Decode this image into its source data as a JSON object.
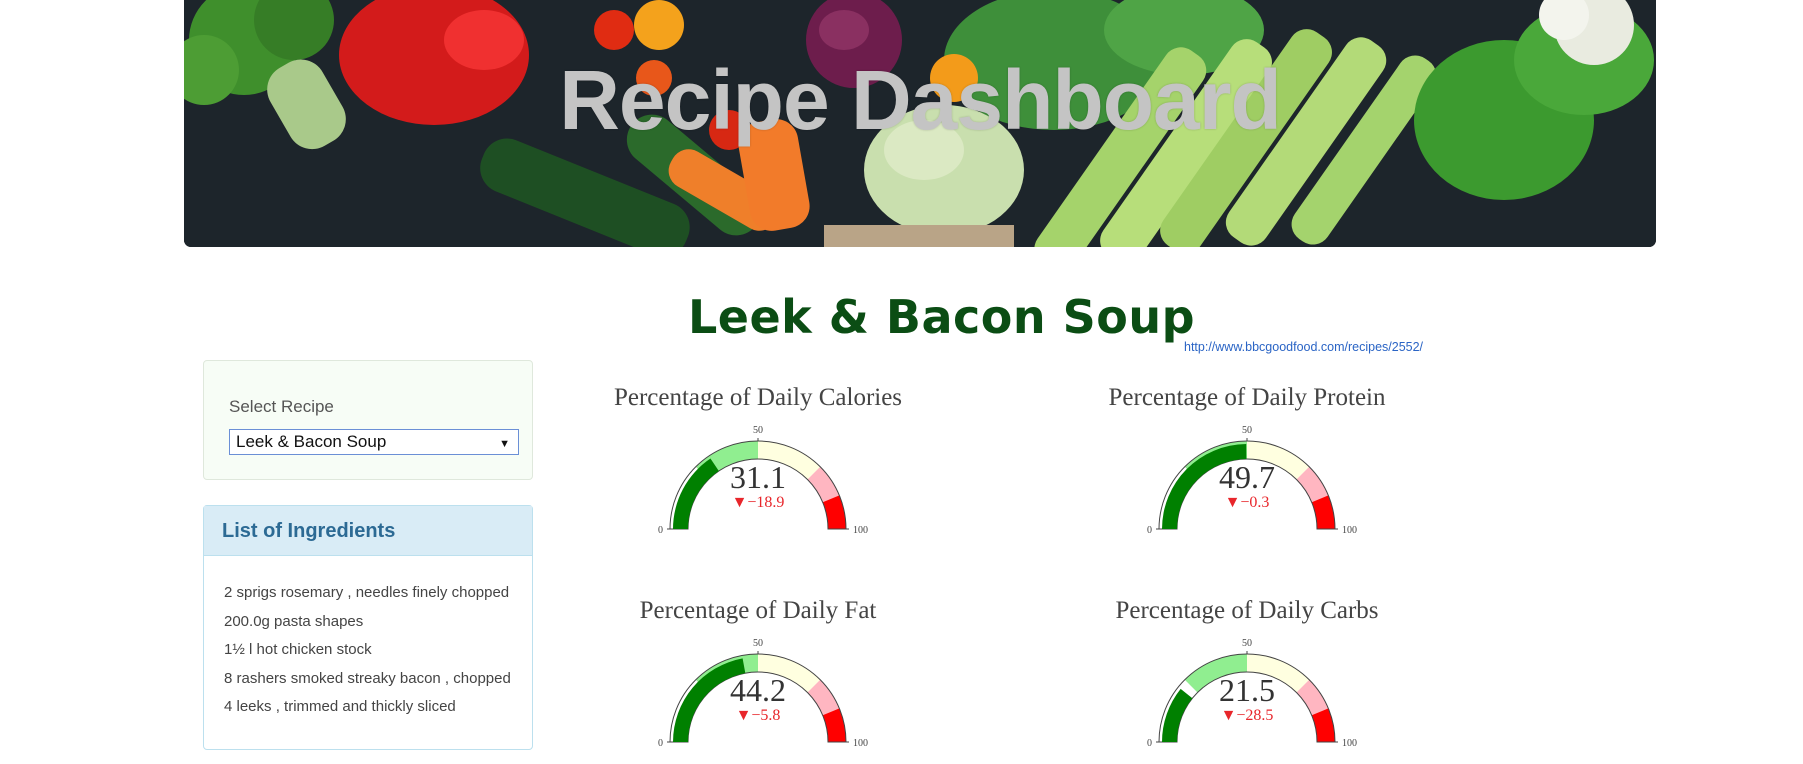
{
  "header": {
    "title": "Recipe Dashboard"
  },
  "recipe": {
    "name": "Leek & Bacon Soup",
    "url": "http://www.bbcgoodfood.com/recipes/2552/"
  },
  "select": {
    "label": "Select Recipe",
    "selected": "Leek & Bacon Soup"
  },
  "ingredients": {
    "title": "List of Ingredients",
    "items": [
      "2 sprigs rosemary , needles finely chopped",
      "200.0g pasta shapes",
      "1½ l hot chicken stock",
      "8 rashers smoked streaky bacon , chopped",
      "4 leeks , trimmed and thickly sliced"
    ]
  },
  "colors": {
    "bar": "#008000",
    "band_low": "#90ee90",
    "band_mid": "#ffffe0",
    "band_high": "#ffb6c1",
    "band_max": "#ff0000",
    "title_green": "#0b4d14",
    "link": "#2a64c5",
    "delta": "#e8262b"
  },
  "gauges": [
    {
      "title": "Percentage of Daily Calories",
      "value": "31.1",
      "delta": "▼−18.9",
      "level": 31.1
    },
    {
      "title": "Percentage of Daily Protein",
      "value": "49.7",
      "delta": "▼−0.3",
      "level": 49.7
    },
    {
      "title": "Percentage of Daily Fat",
      "value": "44.2",
      "delta": "▼−5.8",
      "level": 44.2
    },
    {
      "title": "Percentage of Daily Carbs",
      "value": "21.5",
      "delta": "▼−28.5",
      "level": 21.5
    }
  ],
  "gauge_axis": {
    "min": "0",
    "mid": "50",
    "max": "100",
    "range": [
      0,
      100
    ],
    "bands": [
      0,
      25,
      50,
      75,
      87.5,
      100
    ]
  }
}
